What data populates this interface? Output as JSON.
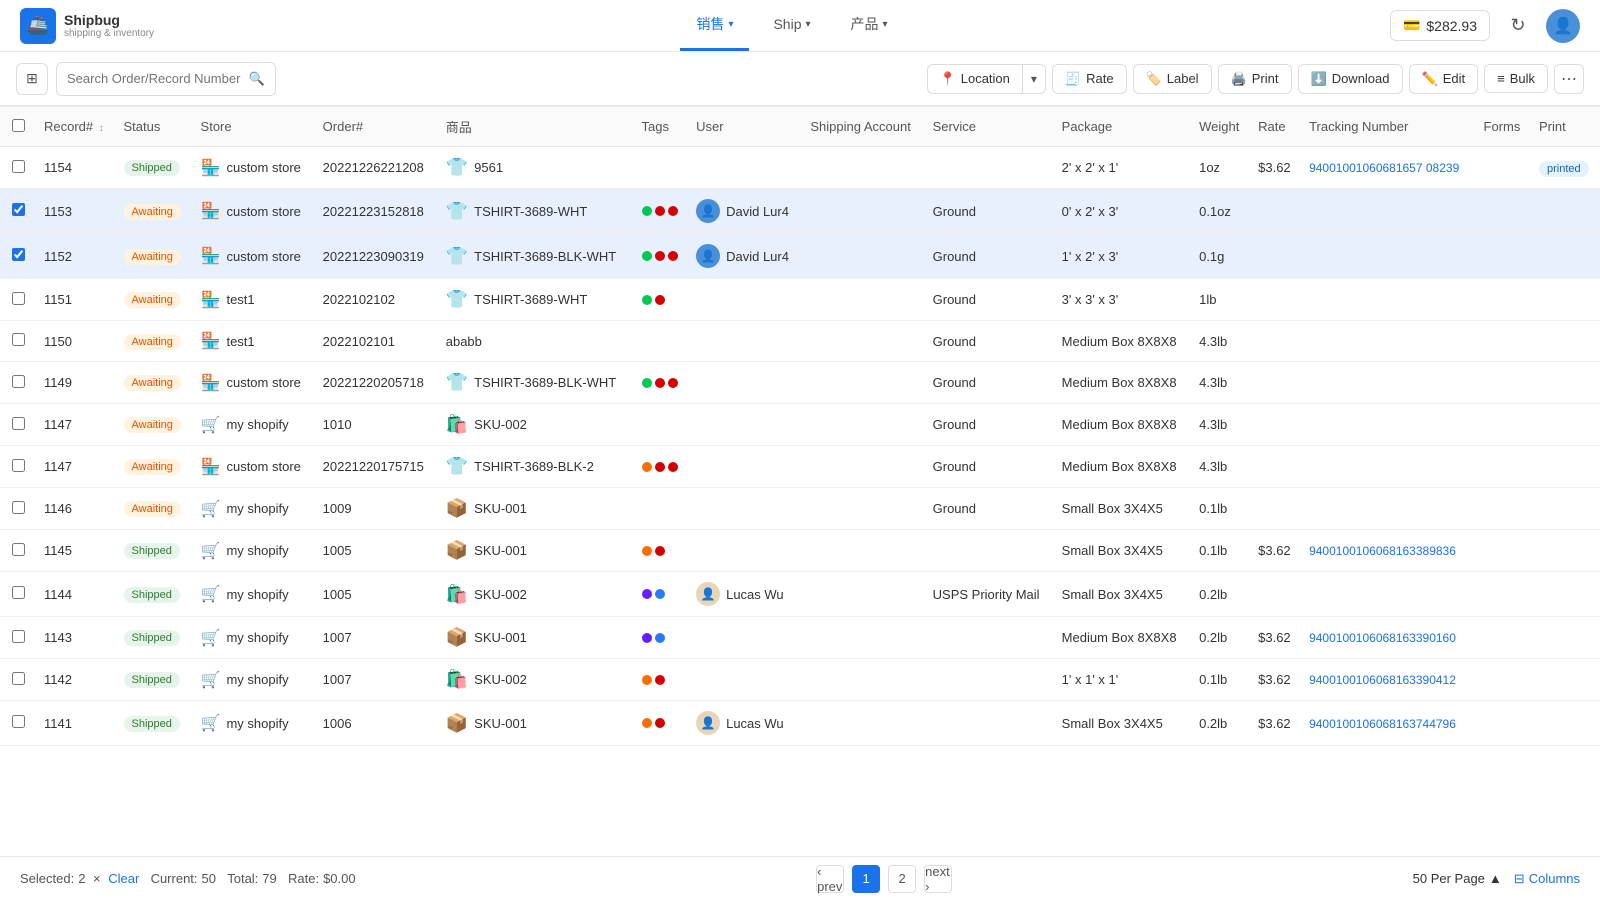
{
  "app": {
    "name": "Shipbug",
    "subtitle": "shipping & inventory",
    "balance": "$282.93"
  },
  "nav": {
    "tabs": [
      {
        "id": "sales",
        "label": "销售",
        "active": true
      },
      {
        "id": "ship",
        "label": "Ship",
        "active": false
      },
      {
        "id": "products",
        "label": "产品",
        "active": false
      }
    ]
  },
  "toolbar": {
    "search_placeholder": "Search Order/Record Number",
    "buttons": {
      "location": "Location",
      "rate": "Rate",
      "label": "Label",
      "print": "Print",
      "download": "Download",
      "edit": "Edit",
      "bulk": "Bulk"
    }
  },
  "table": {
    "columns": [
      "Record#",
      "Status",
      "Store",
      "Order#",
      "商品",
      "Tags",
      "User",
      "Shipping Account",
      "Service",
      "Package",
      "Weight",
      "Rate",
      "Tracking Number",
      "Forms",
      "Print"
    ],
    "rows": [
      {
        "id": "1154",
        "status": "Shipped",
        "store": "custom store",
        "store_type": "custom",
        "order": "20221226221208",
        "product": "9561",
        "product_icon": "👕",
        "tags": [],
        "user": "",
        "shipping_account": "",
        "service": "",
        "package": "2' x 2' x 1'",
        "weight": "1oz",
        "rate": "$3.62",
        "tracking": "94001001060681657 08239",
        "tracking_full": "9400100106068165708239",
        "forms": "",
        "print": "printed",
        "selected": false,
        "checked": false
      },
      {
        "id": "1153",
        "status": "Awaiting",
        "store": "custom store",
        "store_type": "custom",
        "order": "20221223152818",
        "product": "TSHIRT-3689-WHT",
        "product_icon": "👕",
        "tags": [
          "#00c853",
          "#d50000",
          "#d50000"
        ],
        "user": "David Lur4",
        "user_color": "#4a90d9",
        "shipping_account": "",
        "service": "Ground",
        "package": "0' x 2' x 3'",
        "weight": "0.1oz",
        "rate": "",
        "tracking": "",
        "forms": "",
        "print": "",
        "selected": true,
        "checked": true
      },
      {
        "id": "1152",
        "status": "Awaiting",
        "store": "custom store",
        "store_type": "custom",
        "order": "20221223090319",
        "product": "TSHIRT-3689-BLK-WHT",
        "product_icon": "👕",
        "tags": [
          "#00c853",
          "#d50000",
          "#d50000"
        ],
        "user": "David Lur4",
        "user_color": "#4a90d9",
        "shipping_account": "",
        "service": "Ground",
        "package": "1' x 2' x 3'",
        "weight": "0.1g",
        "rate": "",
        "tracking": "",
        "forms": "",
        "print": "",
        "selected": true,
        "checked": true
      },
      {
        "id": "1151",
        "status": "Awaiting",
        "store": "test1",
        "store_type": "custom",
        "order": "2022102102",
        "product": "TSHIRT-3689-WHT",
        "product_icon": "👕",
        "tags": [
          "#00c853",
          "#d50000"
        ],
        "user": "",
        "shipping_account": "",
        "service": "Ground",
        "package": "3' x 3' x 3'",
        "weight": "1lb",
        "rate": "",
        "tracking": "",
        "forms": "",
        "print": "",
        "selected": false,
        "checked": false
      },
      {
        "id": "1150",
        "status": "Awaiting",
        "store": "test1",
        "store_type": "custom",
        "order": "2022102101",
        "product": "ababb",
        "product_icon": "",
        "tags": [],
        "user": "",
        "shipping_account": "",
        "service": "Ground",
        "package": "Medium Box 8X8X8",
        "weight": "4.3lb",
        "rate": "",
        "tracking": "",
        "forms": "",
        "print": "",
        "selected": false,
        "checked": false
      },
      {
        "id": "1149",
        "status": "Awaiting",
        "store": "custom store",
        "store_type": "custom",
        "order": "20221220205718",
        "product": "TSHIRT-3689-BLK-WHT",
        "product_icon": "👕",
        "tags": [
          "#00c853",
          "#d50000",
          "#d50000"
        ],
        "user": "",
        "shipping_account": "",
        "service": "Ground",
        "package": "Medium Box 8X8X8",
        "weight": "4.3lb",
        "rate": "",
        "tracking": "",
        "forms": "",
        "print": "",
        "selected": false,
        "checked": false
      },
      {
        "id": "1147",
        "status": "Awaiting",
        "store": "my shopify",
        "store_type": "shopify",
        "order": "1010",
        "product": "SKU-002",
        "product_icon": "🛍️",
        "tags": [],
        "user": "",
        "shipping_account": "",
        "service": "Ground",
        "package": "Medium Box 8X8X8",
        "weight": "4.3lb",
        "rate": "",
        "tracking": "",
        "forms": "",
        "print": "",
        "selected": false,
        "checked": false
      },
      {
        "id": "1147",
        "status": "Awaiting",
        "store": "custom store",
        "store_type": "custom",
        "order": "20221220175715",
        "product": "TSHIRT-3689-BLK-2",
        "product_icon": "👕",
        "tags": [
          "#ff6d00",
          "#d50000",
          "#d50000"
        ],
        "user": "",
        "shipping_account": "",
        "service": "Ground",
        "package": "Medium Box 8X8X8",
        "weight": "4.3lb",
        "rate": "",
        "tracking": "",
        "forms": "",
        "print": "",
        "selected": false,
        "checked": false
      },
      {
        "id": "1146",
        "status": "Awaiting",
        "store": "my shopify",
        "store_type": "shopify",
        "order": "1009",
        "product": "SKU-001",
        "product_icon": "📦",
        "tags": [],
        "user": "",
        "shipping_account": "",
        "service": "Ground",
        "package": "Small Box 3X4X5",
        "weight": "0.1lb",
        "rate": "",
        "tracking": "",
        "forms": "",
        "print": "",
        "selected": false,
        "checked": false
      },
      {
        "id": "1145",
        "status": "Shipped",
        "store": "my shopify",
        "store_type": "shopify",
        "order": "1005",
        "product": "SKU-001",
        "product_icon": "📦",
        "tags": [
          "#ff6d00",
          "#d50000"
        ],
        "user": "",
        "shipping_account": "",
        "service": "",
        "package": "Small Box 3X4X5",
        "weight": "0.1lb",
        "rate": "$3.62",
        "tracking": "9400100106068163389836",
        "forms": "",
        "print": "",
        "selected": false,
        "checked": false
      },
      {
        "id": "1144",
        "status": "Shipped",
        "store": "my shopify",
        "store_type": "shopify",
        "order": "1005",
        "product": "SKU-002",
        "product_icon": "🛍️",
        "tags": [
          "#651fff",
          "#2979ff"
        ],
        "user": "Lucas Wu",
        "user_color": "#e8d5b7",
        "shipping_account": "",
        "service": "USPS Priority Mail",
        "package": "Small Box 3X4X5",
        "weight": "0.2lb",
        "rate": "",
        "tracking": "",
        "forms": "",
        "print": "",
        "selected": false,
        "checked": false
      },
      {
        "id": "1143",
        "status": "Shipped",
        "store": "my shopify",
        "store_type": "shopify",
        "order": "1007",
        "product": "SKU-001",
        "product_icon": "📦",
        "tags": [
          "#651fff",
          "#2979ff"
        ],
        "user": "",
        "shipping_account": "",
        "service": "",
        "package": "Medium Box 8X8X8",
        "weight": "0.2lb",
        "rate": "$3.62",
        "tracking": "9400100106068163390160",
        "forms": "",
        "print": "",
        "selected": false,
        "checked": false
      },
      {
        "id": "1142",
        "status": "Shipped",
        "store": "my shopify",
        "store_type": "shopify",
        "order": "1007",
        "product": "SKU-002",
        "product_icon": "🛍️",
        "tags": [
          "#ff6d00",
          "#d50000"
        ],
        "user": "",
        "shipping_account": "",
        "service": "",
        "package": "1' x 1' x 1'",
        "weight": "0.1lb",
        "rate": "$3.62",
        "tracking": "9400100106068163390412",
        "forms": "",
        "print": "",
        "selected": false,
        "checked": false
      },
      {
        "id": "1141",
        "status": "Shipped",
        "store": "my shopify",
        "store_type": "shopify",
        "order": "1006",
        "product": "SKU-001",
        "product_icon": "📦",
        "tags": [
          "#ff6d00",
          "#d50000"
        ],
        "user": "Lucas Wu",
        "user_color": "#e8d5b7",
        "shipping_account": "",
        "service": "",
        "package": "Small Box 3X4X5",
        "weight": "0.2lb",
        "rate": "$3.62",
        "tracking": "9400100106068163744796",
        "forms": "",
        "print": "",
        "selected": false,
        "checked": false
      }
    ]
  },
  "footer": {
    "selected": "2",
    "current": "50",
    "total": "79",
    "rate": "$0.00",
    "page_current": "1",
    "page_total": "2",
    "per_page": "50 Per Page"
  }
}
